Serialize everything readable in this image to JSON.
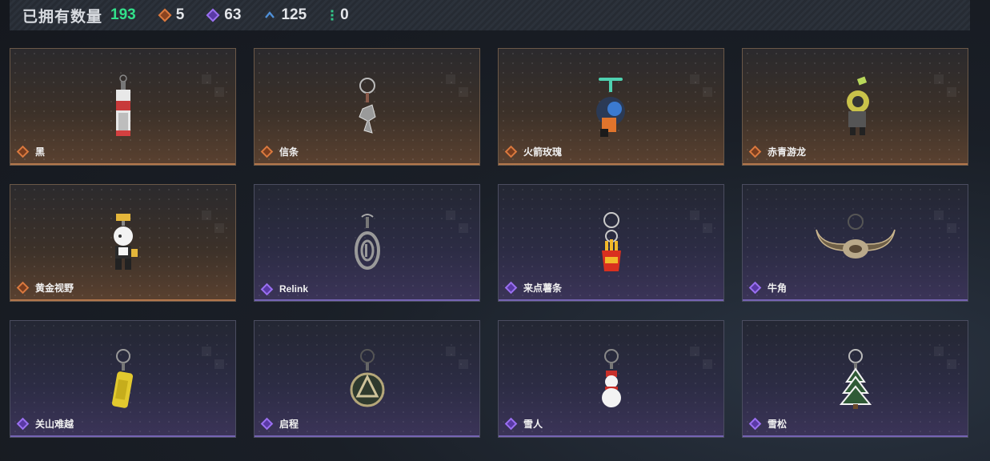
{
  "header": {
    "title": "已拥有数量",
    "total": "193",
    "stats": [
      {
        "icon": "orange-diamond-icon",
        "value": "5",
        "color": "#d9793f"
      },
      {
        "icon": "purple-diamond-icon",
        "value": "63",
        "color": "#9a70f0"
      },
      {
        "icon": "blue-chevron-icon",
        "value": "125",
        "color": "#4f90d8"
      },
      {
        "icon": "green-dots-icon",
        "value": "0",
        "color": "#32c88a"
      }
    ]
  },
  "items": [
    {
      "name": "黑",
      "rarity": "orange",
      "icon": "keychain-tag-icon"
    },
    {
      "name": "信条",
      "rarity": "orange",
      "icon": "keychain-charm-icon"
    },
    {
      "name": "火箭玫瑰",
      "rarity": "orange",
      "icon": "keychain-rocket-figure-icon"
    },
    {
      "name": "赤青游龙",
      "rarity": "orange",
      "icon": "keychain-dragon-figure-icon"
    },
    {
      "name": "黄金视野",
      "rarity": "orange",
      "icon": "keychain-maid-figure-icon"
    },
    {
      "name": "Relink",
      "rarity": "purple",
      "icon": "keychain-medallion-icon"
    },
    {
      "name": "来点薯条",
      "rarity": "purple",
      "icon": "keychain-fries-icon"
    },
    {
      "name": "牛角",
      "rarity": "purple",
      "icon": "keychain-horns-icon"
    },
    {
      "name": "关山难越",
      "rarity": "purple",
      "icon": "keychain-can-icon"
    },
    {
      "name": "启程",
      "rarity": "purple",
      "icon": "keychain-emblem-icon"
    },
    {
      "name": "雪人",
      "rarity": "purple",
      "icon": "keychain-snowman-icon"
    },
    {
      "name": "雪松",
      "rarity": "purple",
      "icon": "keychain-tree-icon"
    }
  ]
}
